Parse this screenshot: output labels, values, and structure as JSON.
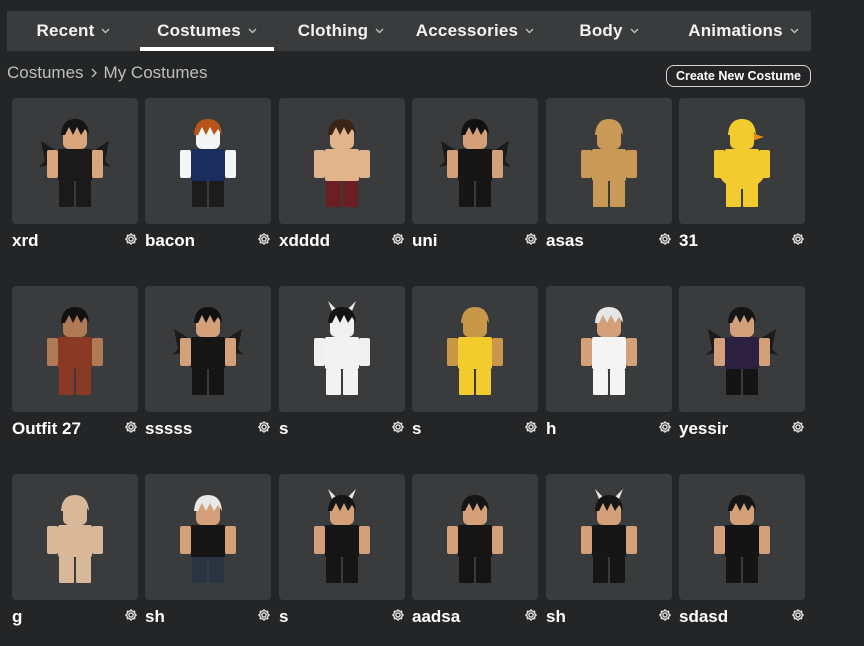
{
  "nav": {
    "tabs": [
      {
        "label": "Recent",
        "active": false
      },
      {
        "label": "Costumes",
        "active": true
      },
      {
        "label": "Clothing",
        "active": false
      },
      {
        "label": "Accessories",
        "active": false
      },
      {
        "label": "Body",
        "active": false
      },
      {
        "label": "Animations",
        "active": false
      }
    ]
  },
  "breadcrumb": {
    "root": "Costumes",
    "current": "My Costumes"
  },
  "create_button": "Create New Costume",
  "icons": {
    "settings": "gear-icon",
    "dropdown": "chevron-down-icon",
    "separator": "chevron-right-icon"
  },
  "costumes": [
    {
      "name": "xrd",
      "hair": "#151515",
      "skin": "#d8a67a",
      "shirt": "#1a1a1a",
      "pants": "#1a1a1a",
      "extra": "wings"
    },
    {
      "name": "bacon",
      "hair": "#b8561a",
      "skin": "#f4f4f4",
      "shirt": "#1a2d5e",
      "pants": "#1c1c1c",
      "extra": ""
    },
    {
      "name": "xdddd",
      "hair": "#3a2418",
      "skin": "#e2b48c",
      "shirt": "#e2b48c",
      "pants": "#6b1f22",
      "extra": ""
    },
    {
      "name": "uni",
      "hair": "#111111",
      "skin": "#d4a07a",
      "shirt": "#161616",
      "pants": "#161616",
      "extra": "wings"
    },
    {
      "name": "asas",
      "hair": "#c99a55",
      "skin": "#c99a55",
      "shirt": "#c99a55",
      "pants": "#c99a55",
      "extra": ""
    },
    {
      "name": "31",
      "hair": "#f2cc2e",
      "skin": "#f2cc2e",
      "shirt": "#f2cc2e",
      "pants": "#f2cc2e",
      "extra": "duck"
    },
    {
      "name": "Outfit 27",
      "hair": "#111111",
      "skin": "#b07a55",
      "shirt": "#8a3a24",
      "pants": "#8a3a24",
      "extra": ""
    },
    {
      "name": "sssss",
      "hair": "#111111",
      "skin": "#d4a07a",
      "shirt": "#151515",
      "pants": "#151515",
      "extra": "wings"
    },
    {
      "name": "s",
      "hair": "#141414",
      "skin": "#f0f0f0",
      "shirt": "#f2f2f2",
      "pants": "#f2f2f2",
      "extra": "horns"
    },
    {
      "name": "s",
      "hair": "#c89848",
      "skin": "#c89848",
      "shirt": "#f2cc2e",
      "pants": "#f2cc2e",
      "extra": ""
    },
    {
      "name": "h",
      "hair": "#e6e6e6",
      "skin": "#d4a07a",
      "shirt": "#f4f4f4",
      "pants": "#f4f4f4",
      "extra": ""
    },
    {
      "name": "yessir",
      "hair": "#151515",
      "skin": "#d4a07a",
      "shirt": "#2b2040",
      "pants": "#141414",
      "extra": "wings"
    },
    {
      "name": "g",
      "hair": "#d8b898",
      "skin": "#d8b898",
      "shirt": "#d8b898",
      "pants": "#d8b898",
      "extra": ""
    },
    {
      "name": "sh",
      "hair": "#e8e8e8",
      "skin": "#d4a07a",
      "shirt": "#161616",
      "pants": "#2a3442",
      "extra": ""
    },
    {
      "name": "s",
      "hair": "#151515",
      "skin": "#d4a07a",
      "shirt": "#161616",
      "pants": "#161616",
      "extra": "horns"
    },
    {
      "name": "aadsa",
      "hair": "#151515",
      "skin": "#d4a07a",
      "shirt": "#151515",
      "pants": "#151515",
      "extra": ""
    },
    {
      "name": "sh",
      "hair": "#151515",
      "skin": "#d4a07a",
      "shirt": "#161616",
      "pants": "#161616",
      "extra": "horns"
    },
    {
      "name": "sdasd",
      "hair": "#151515",
      "skin": "#d4a07a",
      "shirt": "#141414",
      "pants": "#141414",
      "extra": ""
    }
  ]
}
